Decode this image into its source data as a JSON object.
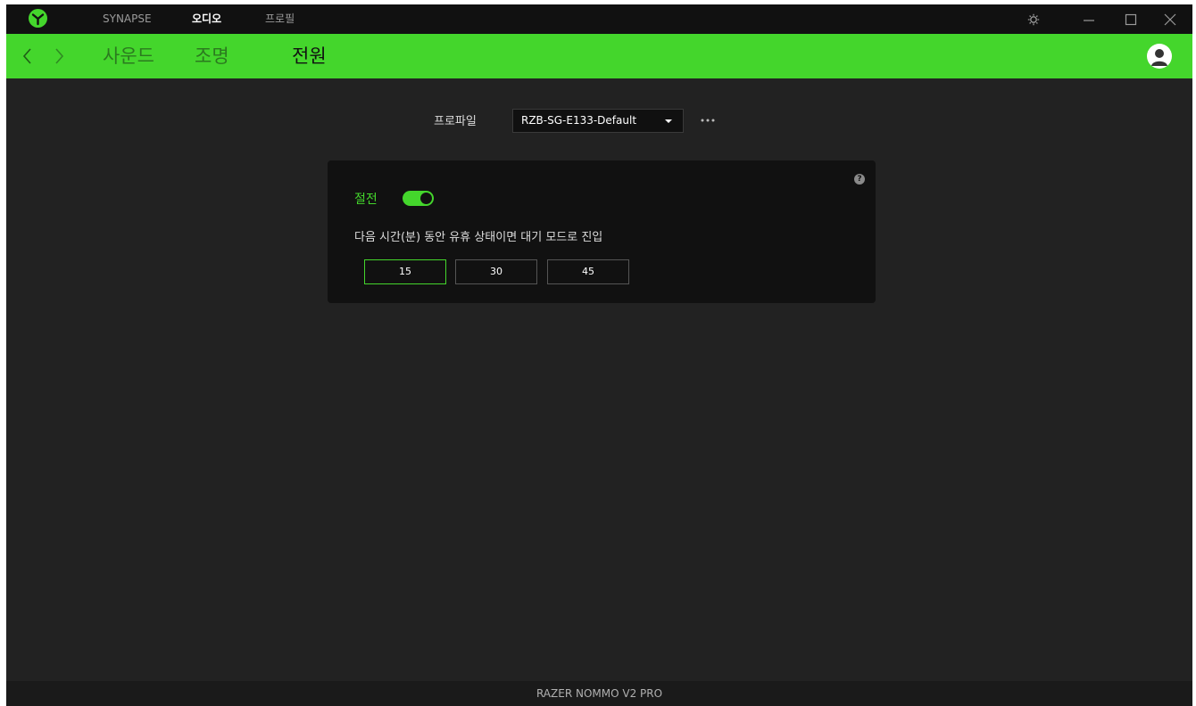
{
  "titlebar": {
    "tabs": [
      {
        "label": "SYNAPSE"
      },
      {
        "label": "오디오"
      },
      {
        "label": "프로필"
      }
    ]
  },
  "greenbar": {
    "subtabs": [
      {
        "label": "사운드"
      },
      {
        "label": "조명"
      },
      {
        "label": "전원"
      }
    ]
  },
  "profile": {
    "label": "프로파일",
    "selected": "RZB-SG-E133-Default"
  },
  "power_card": {
    "title": "절전",
    "toggle_on": true,
    "description": "다음 시간(분) 동안 유휴 상태이면 대기 모드로 진입",
    "help_glyph": "?",
    "options": [
      "15",
      "30",
      "45"
    ],
    "selected_option": "15"
  },
  "footer": {
    "device_name": "RAZER NOMMO V2 PRO"
  },
  "colors": {
    "accent": "#44d62c",
    "background": "#222222",
    "titlebar": "#111111",
    "card": "#111111"
  }
}
